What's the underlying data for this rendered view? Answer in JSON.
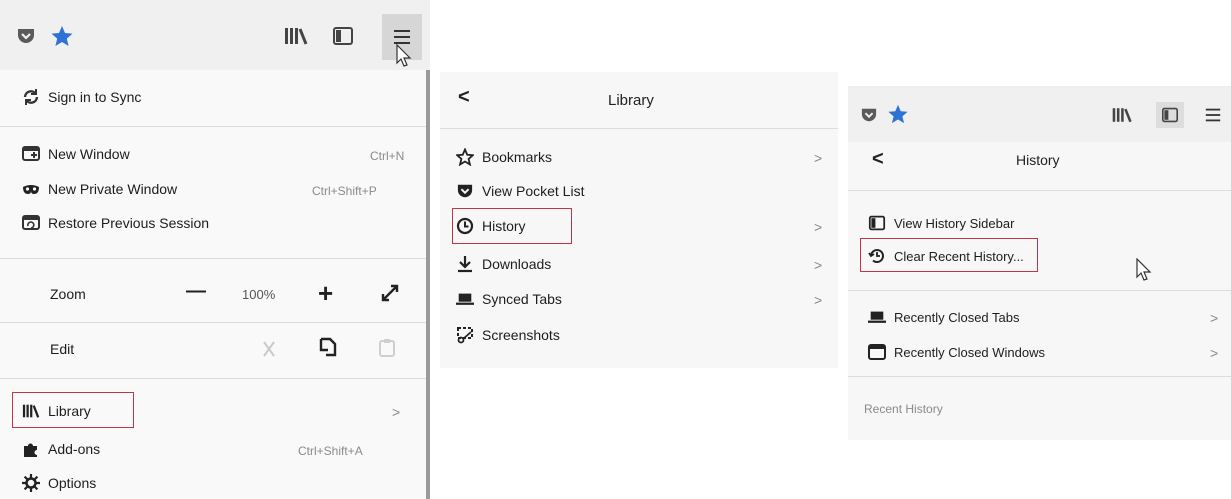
{
  "panel1": {
    "menu": {
      "sync": "Sign in to Sync",
      "new_window": "New Window",
      "new_window_shortcut": "Ctrl+N",
      "new_private": "New Private Window",
      "new_private_shortcut": "Ctrl+Shift+P",
      "restore": "Restore Previous Session",
      "zoom": "Zoom",
      "zoom_minus": "—",
      "zoom_value": "100%",
      "zoom_plus": "+",
      "edit": "Edit",
      "library": "Library",
      "library_chevron": ">",
      "addons": "Add-ons",
      "addons_shortcut": "Ctrl+Shift+A",
      "options": "Options"
    }
  },
  "panel2": {
    "title": "Library",
    "back": "<",
    "items": [
      {
        "label": "Bookmarks",
        "chevron": ">"
      },
      {
        "label": "View Pocket List",
        "chevron": ""
      },
      {
        "label": "History",
        "chevron": ">"
      },
      {
        "label": "Downloads",
        "chevron": ">"
      },
      {
        "label": "Synced Tabs",
        "chevron": ">"
      },
      {
        "label": "Screenshots",
        "chevron": ""
      }
    ]
  },
  "panel3": {
    "title": "History",
    "back": "<",
    "items": [
      {
        "label": "View History Sidebar",
        "chevron": ""
      },
      {
        "label": "Clear Recent History...",
        "chevron": ""
      },
      {
        "label": "Recently Closed Tabs",
        "chevron": ">"
      },
      {
        "label": "Recently Closed Windows",
        "chevron": ">"
      }
    ],
    "section": "Recent History"
  },
  "colors": {
    "accent_star": "#2f72d6",
    "highlight_border": "#c0354a",
    "pocket_red": "#d7224b"
  }
}
